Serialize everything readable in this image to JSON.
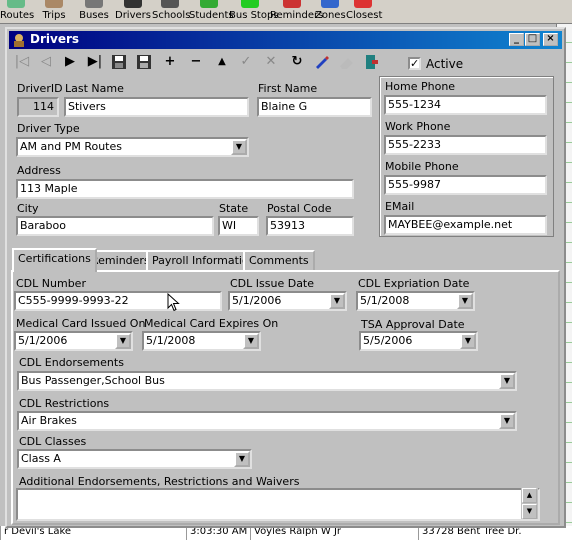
{
  "app_toolbar": {
    "items": [
      "Routes",
      "Trips",
      "Buses",
      "Drivers",
      "Schools",
      "Students",
      "Bus Stops",
      "Reminders",
      "Zones",
      "Closest"
    ]
  },
  "background_grid": {
    "row_cells": [
      "r Devil's Lake",
      "3:03:30 AM",
      "Voyles Ralph W Jr",
      "33728 Bent Tree Dr."
    ]
  },
  "window": {
    "title": "Drivers",
    "title_icon": "drivers-app-icon",
    "controls": {
      "minimize": "_",
      "maximize": "□",
      "close": "×"
    }
  },
  "nav_toolbar": {
    "buttons": [
      "first",
      "prev",
      "next",
      "last",
      "save-record",
      "save-all",
      "add",
      "delete",
      "up",
      "check",
      "cancel",
      "refresh",
      "edit",
      "clear",
      "exit"
    ],
    "active_label": "Active",
    "active_checked": true
  },
  "form": {
    "driver_id_label": "DriverID",
    "driver_id": "114",
    "last_name_label": "Last Name",
    "last_name": "Stivers",
    "first_name_label": "First Name",
    "first_name": "Blaine G",
    "driver_type_label": "Driver Type",
    "driver_type": "AM and PM Routes",
    "address_label": "Address",
    "address": "113 Maple",
    "city_label": "City",
    "city": "Baraboo",
    "state_label": "State",
    "state": "WI",
    "postal_label": "Postal Code",
    "postal": "53913"
  },
  "phones": {
    "home_label": "Home Phone",
    "home": "555-1234",
    "work_label": "Work Phone",
    "work": "555-2233",
    "mobile_label": "Mobile Phone",
    "mobile": "555-9987",
    "email_label": "EMail",
    "email": "MAYBEE@example.net"
  },
  "tabs": {
    "items": [
      "Certifications",
      "Reminders",
      "Payroll Information",
      "Comments"
    ],
    "active": "Certifications"
  },
  "certifications": {
    "cdl_number_label": "CDL Number",
    "cdl_number": "C555-9999-9993-22",
    "cdl_issue_label": "CDL Issue Date",
    "cdl_issue": "5/1/2006",
    "cdl_exp_label": "CDL Expriation Date",
    "cdl_exp": "5/1/2008",
    "med_issued_label": "Medical Card Issued On",
    "med_issued": "5/1/2006",
    "med_expires_label": "Medical Card Expires On",
    "med_expires": "5/1/2008",
    "tsa_label": "TSA Approval Date",
    "tsa": "5/5/2006",
    "endorsements_label": "CDL Endorsements",
    "endorsements": "Bus Passenger,School Bus",
    "restrictions_label": "CDL Restrictions",
    "restrictions": "Air Brakes",
    "classes_label": "CDL Classes",
    "classes": "Class A",
    "additional_label": "Additional Endorsements, Restrictions and Waivers",
    "additional": ""
  }
}
